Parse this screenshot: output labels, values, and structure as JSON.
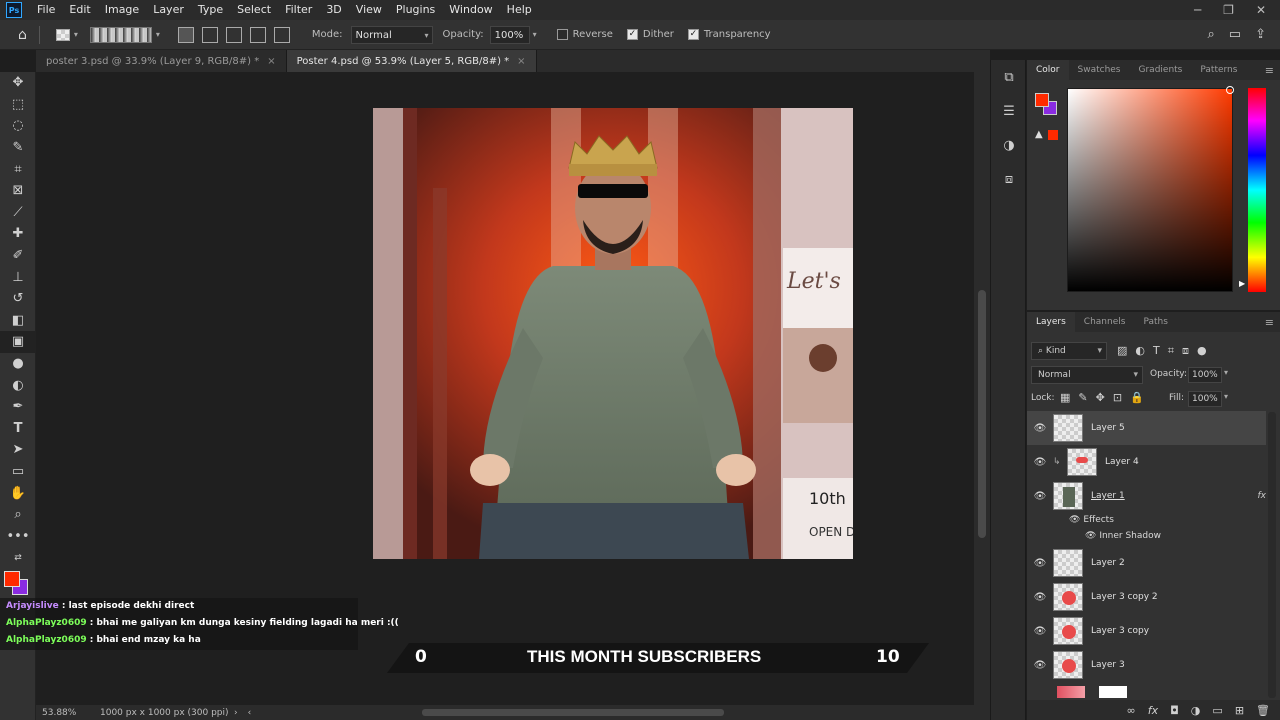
{
  "menubar": {
    "logo": "Ps",
    "items": [
      "File",
      "Edit",
      "Image",
      "Layer",
      "Type",
      "Select",
      "Filter",
      "3D",
      "View",
      "Plugins",
      "Window",
      "Help"
    ],
    "controls": [
      "─",
      "❐",
      "✕"
    ]
  },
  "options": {
    "mode_label": "Mode:",
    "mode_value": "Normal",
    "opacity_label": "Opacity:",
    "opacity_value": "100%",
    "reverse_label": "Reverse",
    "reverse_checked": false,
    "dither_label": "Dither",
    "dither_checked": true,
    "transparency_label": "Transparency",
    "transparency_checked": true
  },
  "tabs": [
    {
      "label": "poster 3.psd @ 33.9% (Layer 9, RGB/8#) *",
      "active": false
    },
    {
      "label": "Poster 4.psd @ 53.9% (Layer 5, RGB/8#) *",
      "active": true
    }
  ],
  "status": {
    "zoom": "53.88%",
    "doc_info": "1000 px x 1000 px (300 ppi)"
  },
  "chat": [
    {
      "user": "Arjayislive",
      "text": " : last episode dekhi direct",
      "user_color": "purple"
    },
    {
      "user": "AlphaPlayz0609",
      "text": " : bhai me galiyan km dunga kesiny fielding lagadi ha meri :((",
      "user_color": "green"
    },
    {
      "user": "AlphaPlayz0609",
      "text": " : bhai end mzay ka ha",
      "user_color": "green"
    }
  ],
  "banner": {
    "left_count": "0",
    "title": "THIS MONTH SUBSCRIBERS",
    "right_count": "10"
  },
  "artwork": {
    "sign_text": "Let's",
    "tenth_text": "10th",
    "open_text": "OPEN D"
  },
  "color_panel": {
    "tabs": [
      "Color",
      "Swatches",
      "Gradients",
      "Patterns"
    ],
    "foreground": "#ff2a00",
    "background": "#8a2be2"
  },
  "layers_panel": {
    "tabs": [
      "Layers",
      "Channels",
      "Paths"
    ],
    "filter_kind": "Kind",
    "blend_mode": "Normal",
    "opacity_label": "Opacity:",
    "opacity_value": "100%",
    "lock_label": "Lock:",
    "fill_label": "Fill:",
    "fill_value": "100%",
    "layers": [
      {
        "name": "Layer 5",
        "selected": true
      },
      {
        "name": "Layer 4",
        "selected": false
      },
      {
        "name": "Layer 1",
        "selected": false,
        "fx": "fx"
      },
      {
        "name": "Layer 2",
        "selected": false
      },
      {
        "name": "Layer 3 copy 2",
        "selected": false
      },
      {
        "name": "Layer 3 copy",
        "selected": false
      },
      {
        "name": "Layer 3",
        "selected": false
      }
    ],
    "effects_label": "Effects",
    "inner_shadow_label": "Inner Shadow"
  }
}
